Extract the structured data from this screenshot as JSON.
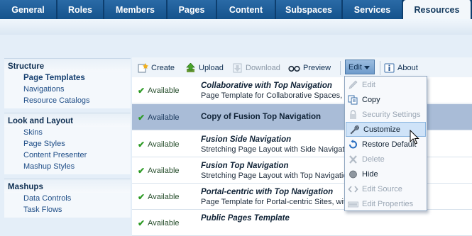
{
  "tabs": [
    {
      "label": "General"
    },
    {
      "label": "Roles"
    },
    {
      "label": "Members"
    },
    {
      "label": "Pages"
    },
    {
      "label": "Content"
    },
    {
      "label": "Subspaces"
    },
    {
      "label": "Services"
    },
    {
      "label": "Resources",
      "active": true
    }
  ],
  "sidebar": {
    "sections": [
      {
        "heading": "Structure",
        "items": [
          "Page Templates",
          "Navigations",
          "Resource Catalogs"
        ],
        "selected": "Page Templates"
      },
      {
        "heading": "Look and Layout",
        "items": [
          "Skins",
          "Page Styles",
          "Content Presenter",
          "Mashup Styles"
        ]
      },
      {
        "heading": "Mashups",
        "items": [
          "Data Controls",
          "Task Flows"
        ]
      }
    ]
  },
  "toolbar": {
    "create": "Create",
    "upload": "Upload",
    "download": "Download",
    "preview": "Preview",
    "edit": "Edit",
    "about": "About"
  },
  "rows": [
    {
      "status": "Available",
      "title": "Collaborative with Top Navigation",
      "desc": "Page Template for Collaborative Spaces, with Top Navigatio"
    },
    {
      "status": "Available",
      "title": "Copy of Fusion Top Navigation",
      "desc": "",
      "selected": true
    },
    {
      "status": "Available",
      "title": "Fusion Side Navigation",
      "desc": "Stretching Page Layout with Side Navigation"
    },
    {
      "status": "Available",
      "title": "Fusion Top Navigation",
      "desc": "Stretching Page Layout with Top Navigation"
    },
    {
      "status": "Available",
      "title": "Portal-centric with Top Navigation",
      "desc": "Page Template for Portal-centric Sites, with Top Navigation. A"
    },
    {
      "status": "Available",
      "title": "Public Pages Template",
      "desc": ""
    }
  ],
  "edit_menu": {
    "items": [
      {
        "label": "Edit",
        "icon": "pencil-icon",
        "disabled": true
      },
      {
        "label": "Copy",
        "icon": "copy-icon"
      },
      {
        "label": "Security Settings",
        "icon": "lock-icon",
        "disabled": true
      },
      {
        "label": "Customize",
        "icon": "wrench-icon",
        "highlighted": true
      },
      {
        "label": "Restore Default",
        "icon": "restore-icon"
      },
      {
        "label": "Delete",
        "icon": "delete-icon",
        "disabled": true
      },
      {
        "label": "Hide",
        "icon": "hide-icon"
      },
      {
        "label": "Edit Source",
        "icon": "code-icon",
        "disabled": true
      },
      {
        "label": "Edit Properties",
        "icon": "properties-icon",
        "disabled": true
      }
    ]
  },
  "colors": {
    "tab_bar": "#0d3e6e",
    "tab": "#2a6aa6",
    "active_tab": "#f3f7fb",
    "selected_row": "#a9bcd7",
    "menu_highlight": "#cfe3f8",
    "available_check": "#2c9a24"
  }
}
